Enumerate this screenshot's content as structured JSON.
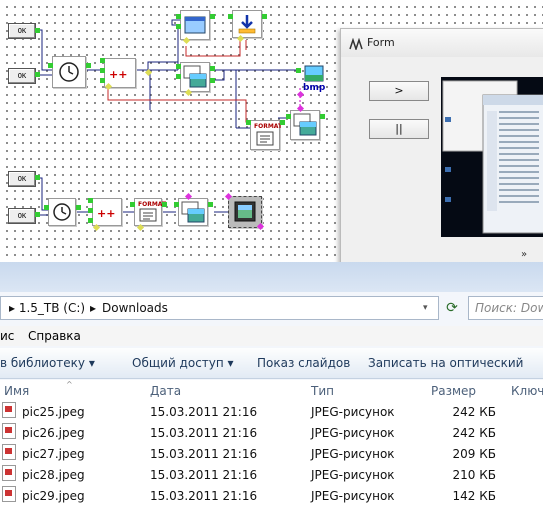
{
  "canvas": {
    "ok_buttons": [
      "OK",
      "OK",
      "OK",
      "OK"
    ],
    "plus_labels": [
      "++",
      "++"
    ],
    "format_labels": [
      "FORMAT",
      "FORMAT"
    ],
    "bmp_label": "bmp"
  },
  "form": {
    "title": "Form",
    "play_label": ">",
    "pause_label": "||"
  },
  "explorer": {
    "breadcrumb": {
      "prefix": "▸ 1.5_TB (C:)",
      "separator": "▸",
      "folder": "Downloads"
    },
    "search_placeholder": "Поиск: Dow",
    "menu": {
      "item1": "ис",
      "item2": "Справка"
    },
    "toolbar": {
      "library": "в библиотеку ▾",
      "share": "Общий доступ ▾",
      "slideshow": "Показ слайдов",
      "burn": "Записать на оптический диск"
    },
    "columns": {
      "name": "Имя",
      "date": "Дата",
      "type": "Тип",
      "size": "Размер",
      "keys": "Ключ"
    },
    "files": [
      {
        "name": "pic25.jpeg",
        "date": "15.03.2011 21:16",
        "type": "JPEG-рисунок",
        "size": "242 КБ"
      },
      {
        "name": "pic26.jpeg",
        "date": "15.03.2011 21:16",
        "type": "JPEG-рисунок",
        "size": "242 КБ"
      },
      {
        "name": "pic27.jpeg",
        "date": "15.03.2011 21:16",
        "type": "JPEG-рисунок",
        "size": "209 КБ"
      },
      {
        "name": "pic28.jpeg",
        "date": "15.03.2011 21:16",
        "type": "JPEG-рисунок",
        "size": "210 КБ"
      },
      {
        "name": "pic29.jpeg",
        "date": "15.03.2011 21:16",
        "type": "JPEG-рисунок",
        "size": "142 КБ"
      }
    ]
  }
}
